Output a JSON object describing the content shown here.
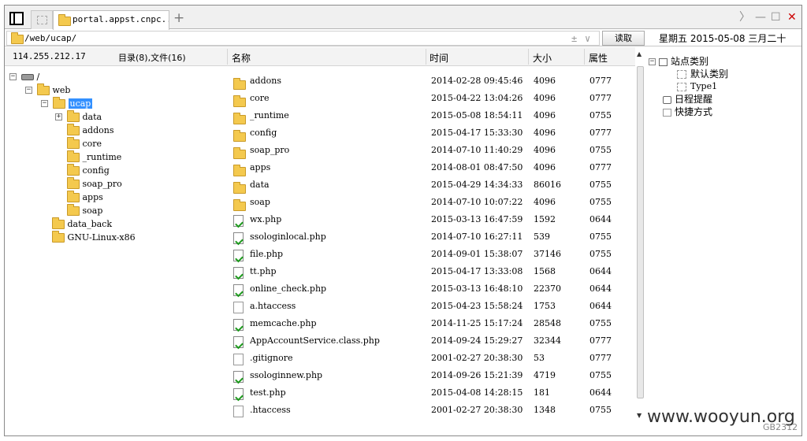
{
  "tabs": [
    {
      "label": ""
    },
    {
      "label": "portal.appst.cnpc..."
    }
  ],
  "tab_add": "+",
  "window_controls": {
    "forward": "〉",
    "minimize": "—",
    "maximize": "☐",
    "close": "✕"
  },
  "address": {
    "path": "/web/ucap/",
    "read_label": "读取",
    "up_down": "±",
    "dropdown": "∨"
  },
  "calendar": {
    "text": "星期五 2015-05-08 三月二十"
  },
  "info": {
    "ip": "114.255.212.17",
    "counts": "目录(8),文件(16)"
  },
  "columns": {
    "name": "名称",
    "time": "时间",
    "size": "大小",
    "perm": "属性"
  },
  "tree": {
    "root": "/",
    "web": "web",
    "ucap": "ucap",
    "children": [
      "data",
      "addons",
      "core",
      "_runtime",
      "config",
      "soap_pro",
      "apps",
      "soap"
    ],
    "data_back": "data_back",
    "gnu": "GNU-Linux-x86"
  },
  "files": [
    {
      "name": "addons",
      "time": "2014-02-28 09:45:46",
      "size": "4096",
      "perm": "0777",
      "type": "folder"
    },
    {
      "name": "core",
      "time": "2015-04-22 13:04:26",
      "size": "4096",
      "perm": "0777",
      "type": "folder"
    },
    {
      "name": "_runtime",
      "time": "2015-05-08 18:54:11",
      "size": "4096",
      "perm": "0755",
      "type": "folder"
    },
    {
      "name": "config",
      "time": "2015-04-17 15:33:30",
      "size": "4096",
      "perm": "0777",
      "type": "folder"
    },
    {
      "name": "soap_pro",
      "time": "2014-07-10 11:40:29",
      "size": "4096",
      "perm": "0755",
      "type": "folder"
    },
    {
      "name": "apps",
      "time": "2014-08-01 08:47:50",
      "size": "4096",
      "perm": "0777",
      "type": "folder"
    },
    {
      "name": "data",
      "time": "2015-04-29 14:34:33",
      "size": "86016",
      "perm": "0755",
      "type": "folder"
    },
    {
      "name": "soap",
      "time": "2014-07-10 10:07:22",
      "size": "4096",
      "perm": "0755",
      "type": "folder"
    },
    {
      "name": "wx.php",
      "time": "2015-03-13 16:47:59",
      "size": "1592",
      "perm": "0644",
      "type": "php"
    },
    {
      "name": "ssologinlocal.php",
      "time": "2014-07-10 16:27:11",
      "size": "539",
      "perm": "0755",
      "type": "php"
    },
    {
      "name": "file.php",
      "time": "2014-09-01 15:38:07",
      "size": "37146",
      "perm": "0755",
      "type": "php"
    },
    {
      "name": "tt.php",
      "time": "2015-04-17 13:33:08",
      "size": "1568",
      "perm": "0644",
      "type": "php"
    },
    {
      "name": "online_check.php",
      "time": "2015-03-13 16:48:10",
      "size": "22370",
      "perm": "0644",
      "type": "php"
    },
    {
      "name": "a.htaccess",
      "time": "2015-04-23 15:58:24",
      "size": "1753",
      "perm": "0644",
      "type": "generic"
    },
    {
      "name": "memcache.php",
      "time": "2014-11-25 15:17:24",
      "size": "28548",
      "perm": "0755",
      "type": "php"
    },
    {
      "name": "AppAccountService.class.php",
      "time": "2014-09-24 15:29:27",
      "size": "32344",
      "perm": "0777",
      "type": "php"
    },
    {
      "name": ".gitignore",
      "time": "2001-02-27 20:38:30",
      "size": "53",
      "perm": "0777",
      "type": "generic"
    },
    {
      "name": "ssologinnew.php",
      "time": "2014-09-26 15:21:39",
      "size": "4719",
      "perm": "0755",
      "type": "php"
    },
    {
      "name": "test.php",
      "time": "2015-04-08 14:28:15",
      "size": "181",
      "perm": "0644",
      "type": "php"
    },
    {
      "name": ".htaccess",
      "time": "2001-02-27 20:38:30",
      "size": "1348",
      "perm": "0755",
      "type": "generic"
    }
  ],
  "right_panel": {
    "site_category": "站点类别",
    "default_category": "默认类别",
    "type1": "Type1",
    "schedule": "日程提醒",
    "shortcut": "快捷方式"
  },
  "watermark": "www.wooyun.org",
  "footer_code": "GB2312",
  "colors": {
    "selection": "#3390ff",
    "folder": "#f4c94e",
    "close": "#cc0000"
  }
}
